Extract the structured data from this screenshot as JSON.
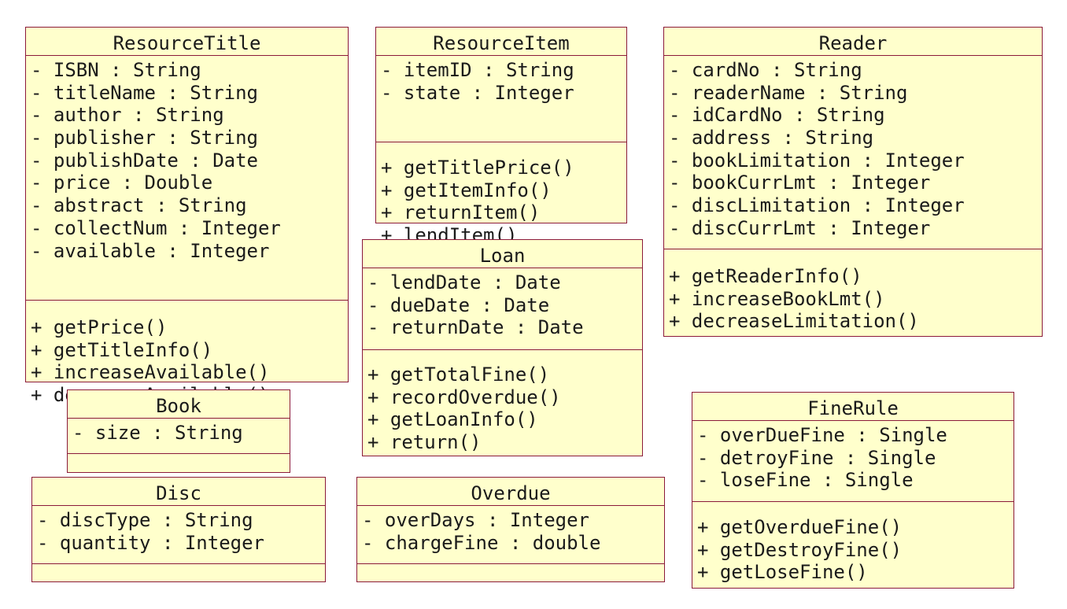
{
  "classes": [
    {
      "name": "ResourceTitle",
      "attributes": [
        "- ISBN : String",
        "- titleName : String",
        "- author : String",
        "- publisher : String",
        "- publishDate : Date",
        "- price : Double",
        "- abstract : String",
        "- collectNum : Integer",
        "- available : Integer"
      ],
      "operations": [
        "+ getPrice()",
        "+ getTitleInfo()",
        "+ increaseAvailable()",
        "+ decreaseAvailable()"
      ]
    },
    {
      "name": "ResourceItem",
      "attributes": [
        "- itemID : String",
        "- state : Integer"
      ],
      "operations": [
        "+ getTitlePrice()",
        "+ getItemInfo()",
        "+ returnItem()",
        "+ lendItem()"
      ]
    },
    {
      "name": "Reader",
      "attributes": [
        "- cardNo : String",
        "- readerName : String",
        "- idCardNo : String",
        "- address : String",
        "- bookLimitation : Integer",
        "- bookCurrLmt : Integer",
        "- discLimitation : Integer",
        "- discCurrLmt : Integer"
      ],
      "operations": [
        "+ getReaderInfo()",
        "+ increaseBookLmt()",
        "+ decreaseLimitation()"
      ]
    },
    {
      "name": "Loan",
      "attributes": [
        "- lendDate : Date",
        "- dueDate : Date",
        "- returnDate : Date"
      ],
      "operations": [
        "+ getTotalFine()",
        "+ recordOverdue()",
        "+ getLoanInfo()",
        "+ return()"
      ]
    },
    {
      "name": "Book",
      "attributes": [
        "- size : String"
      ],
      "operations": []
    },
    {
      "name": "Disc",
      "attributes": [
        "- discType : String",
        "- quantity : Integer"
      ],
      "operations": []
    },
    {
      "name": "Overdue",
      "attributes": [
        "- overDays : Integer",
        "- chargeFine : double"
      ],
      "operations": []
    },
    {
      "name": "FineRule",
      "attributes": [
        "- overDueFine : Single",
        "- detroyFine : Single",
        "- loseFine : Single"
      ],
      "operations": [
        "+ getOverdueFine()",
        "+ getDestroyFine()",
        "+ getLoseFine()"
      ]
    }
  ]
}
